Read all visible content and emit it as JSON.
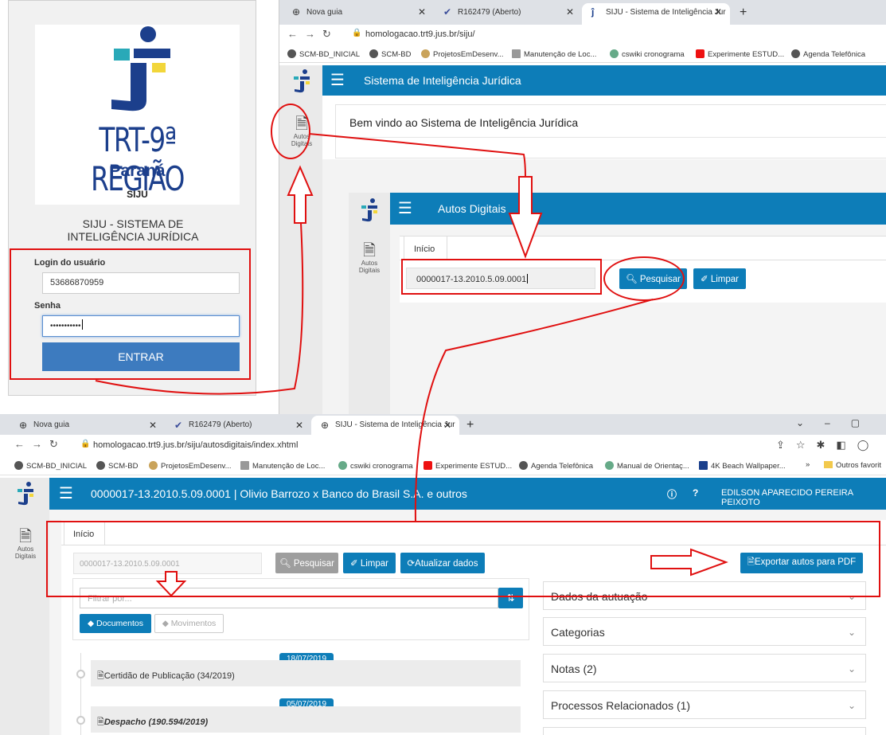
{
  "login": {
    "logo_title": "TRT-9ª REGIÃO",
    "logo_subtitle": "Paraná",
    "logo_siju": "SIJU",
    "system_title_line1": "SIJU - SISTEMA DE",
    "system_title_line2": "INTELIGÊNCIA JURÍDICA",
    "user_label": "Login do usuário",
    "user_value": "53686870959",
    "password_label": "Senha",
    "password_value": "•••••••••••",
    "submit_label": "ENTRAR"
  },
  "browser1": {
    "tabs": [
      {
        "label": "Nova guia",
        "icon": "globe-icon"
      },
      {
        "label": "R162479 (Aberto)",
        "icon": "redmine-icon"
      },
      {
        "label": "SIJU - Sistema de Inteligência Jur",
        "icon": "siju-icon"
      }
    ],
    "url": "homologacao.trt9.jus.br/siju/",
    "bookmarks": [
      "SCM-BD_INICIAL",
      "SCM-BD",
      "ProjetosEmDesenv...",
      "Manutenção de Loc...",
      "cswiki cronograma",
      "Experimente ESTUD...",
      "Agenda Telefônica"
    ],
    "header_title": "Sistema de Inteligência Jurídica",
    "sidebar_item": "Autos Digitais",
    "welcome": "Bem vindo ao Sistema de Inteligência Jurídica",
    "inner": {
      "header_title": "Autos Digitais",
      "sidebar_item": "Autos Digitais",
      "tab": "Início",
      "process_number": "0000017-13.2010.5.09.0001",
      "search_label": "Pesquisar",
      "clear_label": "Limpar"
    }
  },
  "browser2": {
    "tabs": [
      {
        "label": "Nova guia"
      },
      {
        "label": "R162479 (Aberto)"
      },
      {
        "label": "SIJU - Sistema de Inteligência Jur"
      }
    ],
    "url": "homologacao.trt9.jus.br/siju/autosdigitais/index.xhtml",
    "bookmarks": [
      "SCM-BD_INICIAL",
      "SCM-BD",
      "ProjetosEmDesenv...",
      "Manutenção de Loc...",
      "cswiki cronograma",
      "Experimente ESTUD...",
      "Agenda Telefônica",
      "Manual de Orientaç...",
      "4K Beach Wallpaper..."
    ],
    "bookmarks_more": "»",
    "other_favorites": "Outros favorit",
    "header_title": "0000017-13.2010.5.09.0001 | Olivio Barrozo x Banco do Brasil S.A. e outros",
    "user_name": "EDILSON APARECIDO PEREIRA PEIXOTO",
    "sidebar_item": "Autos Digitais",
    "tab": "Início",
    "process_number_placeholder": "0000017-13.2010.5.09.0001",
    "search_label": "Pesquisar",
    "clear_label": "Limpar",
    "update_label": "Atualizar dados",
    "export_label": "Exportar autos para PDF",
    "filter_placeholder": "Filtrar por...",
    "documents_label": "Documentos",
    "movements_label": "Movimentos",
    "timeline": [
      {
        "date": "18/07/2019",
        "title": "Certidão de Publicação (34/2019)"
      },
      {
        "date": "05/07/2019",
        "title": "Despacho (190.594/2019)"
      }
    ],
    "accordions": [
      "Dados da autuação",
      "Categorias",
      "Notas (2)",
      "Processos Relacionados (1)"
    ]
  },
  "colors": {
    "primary": "#0d7db8",
    "annotation": "#e01010",
    "logo_blue": "#1c3f8c",
    "logo_yellow": "#f2d63a",
    "logo_teal": "#29a9b8"
  }
}
